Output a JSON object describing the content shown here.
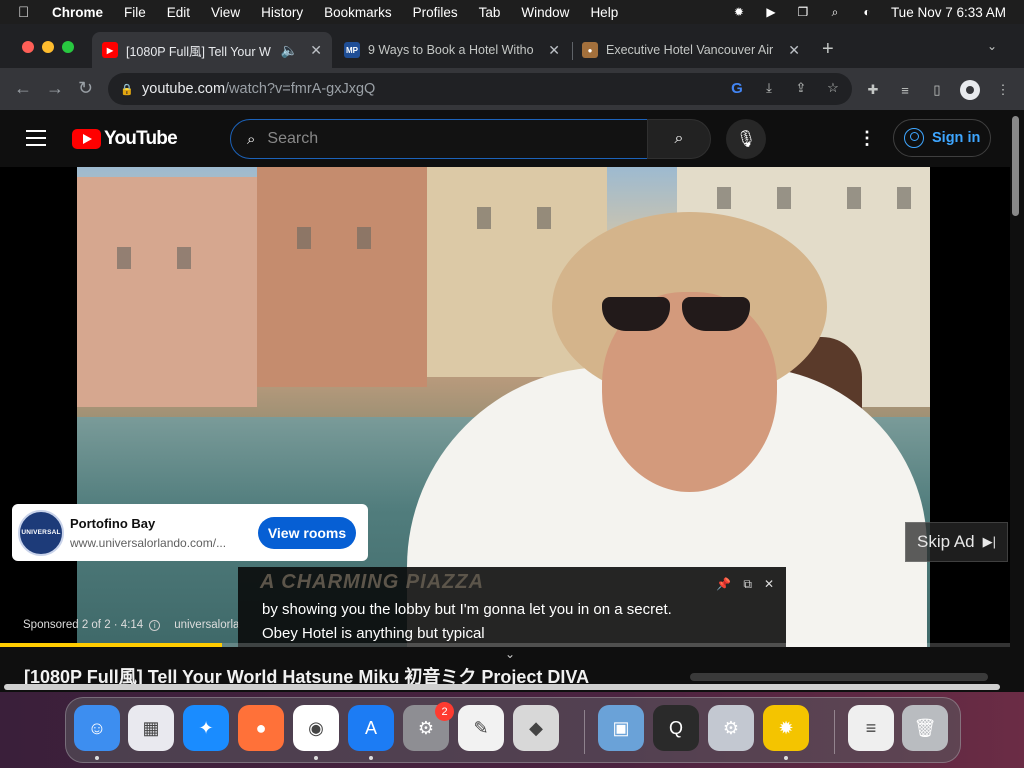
{
  "menubar": {
    "app": "Chrome",
    "items": [
      "File",
      "Edit",
      "View",
      "History",
      "Bookmarks",
      "Profiles",
      "Tab",
      "Window",
      "Help"
    ],
    "datetime": "Tue Nov 7  6:33 AM"
  },
  "tabs": [
    {
      "title": "[1080P Full風] Tell Your W",
      "favicon": "youtube-icon",
      "active": true
    },
    {
      "title": "9 Ways to Book a Hotel Witho",
      "favicon": "MP",
      "active": false
    },
    {
      "title": "Executive Hotel Vancouver Air",
      "favicon": "hotel-icon",
      "active": false
    }
  ],
  "address": {
    "host": "youtube.com",
    "path": "/watch?v=fmrA-gxJxgQ"
  },
  "youtube": {
    "logo_text": "YouTube",
    "search_placeholder": "Search",
    "signin_label": "Sign in"
  },
  "ad": {
    "title": "Portofino Bay",
    "url": "www.universalorlando.com/...",
    "logo_text": "UNIVERSAL",
    "cta": "View rooms",
    "skip_label": "Skip Ad",
    "sponsored_text": "Sponsored 2 of 2 · 4:14",
    "sponsored_domain": "universalorla"
  },
  "captions": {
    "ghost": "A CHARMING PIAZZA",
    "line1": "by showing you the lobby but I'm gonna let you in on a secret.",
    "line2": "Obey Hotel is anything but typical"
  },
  "video": {
    "title": "[1080P Full風] Tell Your World  Hatsune Miku 初音ミク Project DIVA",
    "progress_percent": 22
  },
  "dock": {
    "apps": [
      {
        "name": "Finder",
        "color": "#3d8ef0",
        "glyph": "☺",
        "running": true
      },
      {
        "name": "Launchpad",
        "color": "#e9e9ef",
        "glyph": "▦",
        "running": false
      },
      {
        "name": "Safari",
        "color": "#1a8cff",
        "glyph": "✦",
        "running": false
      },
      {
        "name": "Firefox",
        "color": "#ff7139",
        "glyph": "●",
        "running": false
      },
      {
        "name": "Chrome",
        "color": "#ffffff",
        "glyph": "◉",
        "running": true
      },
      {
        "name": "App Store",
        "color": "#1c7cf4",
        "glyph": "A",
        "running": true
      },
      {
        "name": "System Settings",
        "color": "#8e8e93",
        "glyph": "⚙",
        "running": false,
        "badge": "2"
      },
      {
        "name": "TextEdit",
        "color": "#f2f2f2",
        "glyph": "✎",
        "running": false
      },
      {
        "name": "Roblox",
        "color": "#d8d8d8",
        "glyph": "◆",
        "running": false
      },
      {
        "name": "Preview",
        "color": "#6aa2d8",
        "glyph": "▣",
        "running": false
      },
      {
        "name": "QuickTime",
        "color": "#2a2a2a",
        "glyph": "Q",
        "running": false
      },
      {
        "name": "Settings Utility",
        "color": "#c3c8d1",
        "glyph": "⚙",
        "running": false
      },
      {
        "name": "Bee App",
        "color": "#f4c400",
        "glyph": "✹",
        "running": true
      },
      {
        "name": "Notes File",
        "color": "#efefef",
        "glyph": "≡",
        "running": false
      },
      {
        "name": "Trash",
        "color": "#b9bcc0",
        "glyph": "🗑",
        "running": false
      }
    ]
  }
}
